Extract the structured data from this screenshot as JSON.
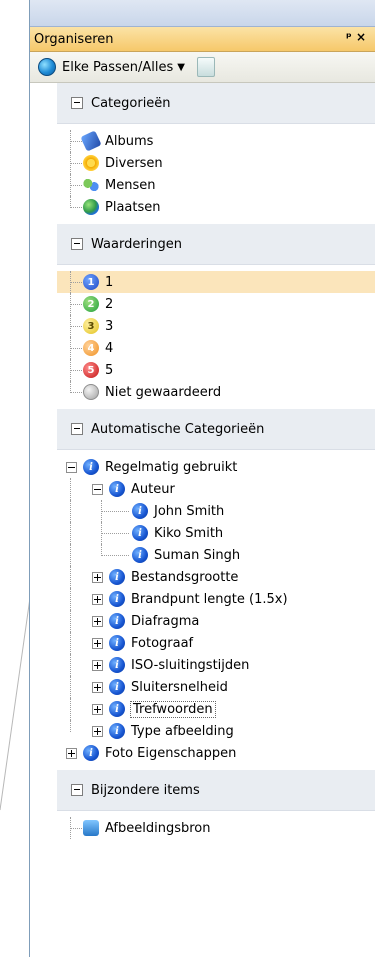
{
  "panel": {
    "title": "Organiseren",
    "pin_icon": "pin-icon",
    "close_icon": "close-icon"
  },
  "toolbar": {
    "scope_label": "Elke Passen/Alles",
    "dropdown_icon": "chevron-down-icon",
    "globe_icon": "globe-icon",
    "tool_icon": "page-icon"
  },
  "sections": {
    "categories": {
      "title": "Categorieën",
      "items": [
        {
          "label": "Albums",
          "icon": "album-icon"
        },
        {
          "label": "Diversen",
          "icon": "flower-icon"
        },
        {
          "label": "Mensen",
          "icon": "people-icon"
        },
        {
          "label": "Plaatsen",
          "icon": "globe-icon"
        }
      ]
    },
    "ratings": {
      "title": "Waarderingen",
      "items": [
        {
          "label": "1",
          "badge": "1"
        },
        {
          "label": "2",
          "badge": "2"
        },
        {
          "label": "3",
          "badge": "3"
        },
        {
          "label": "4",
          "badge": "4"
        },
        {
          "label": "5",
          "badge": "5"
        },
        {
          "label": "Niet gewaardeerd",
          "badge": ""
        }
      ]
    },
    "auto": {
      "title": "Automatische Categorieën",
      "regular": "Regelmatig gebruikt",
      "author": "Auteur",
      "authors": [
        "John Smith",
        "Kiko Smith",
        "Suman Singh"
      ],
      "subitems": [
        "Bestandsgrootte",
        "Brandpunt lengte (1.5x)",
        "Diafragma",
        "Fotograaf",
        "ISO-sluitingstijden",
        "Sluitersnelheid",
        "Trefwoorden",
        "Type afbeelding"
      ],
      "photo_props": "Foto Eigenschappen"
    },
    "special": {
      "title": "Bijzondere items",
      "items": [
        {
          "label": "Afbeeldingsbron",
          "icon": "source-icon"
        }
      ]
    }
  }
}
